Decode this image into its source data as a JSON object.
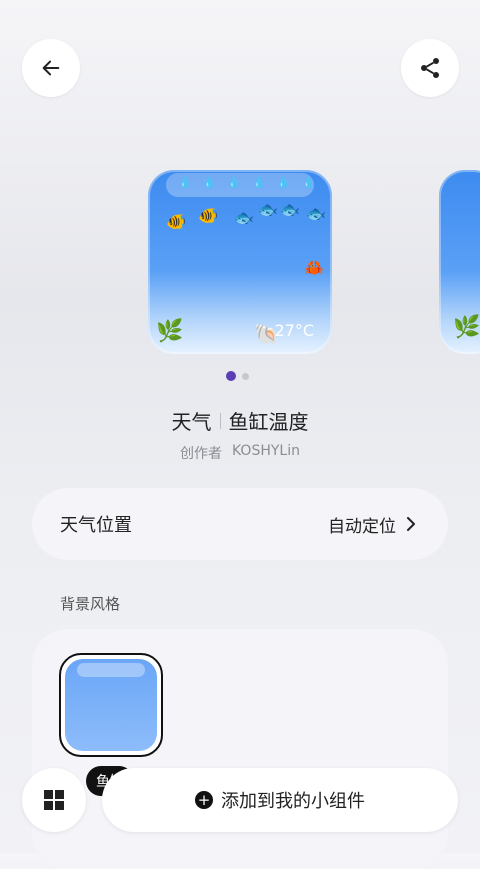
{
  "header": {
    "back_icon": "arrow-left-icon",
    "share_icon": "share-icon"
  },
  "widget": {
    "temperature": "27°C",
    "page_indicator": {
      "count": 2,
      "active": 1
    }
  },
  "info": {
    "title_left": "天气",
    "title_right": "鱼缸温度",
    "author_label": "创作者",
    "author_name": "KOSHYLin"
  },
  "settings": {
    "location_label": "天气位置",
    "location_value": "自动定位"
  },
  "style_section": {
    "label": "背景风格",
    "selected_style": "鱼缸"
  },
  "bottom": {
    "grid_icon": "grid-icon",
    "add_label": "添加到我的小组件"
  },
  "colors": {
    "accent": "#5b3fb5",
    "widget_blue": "#3d8bf0"
  }
}
